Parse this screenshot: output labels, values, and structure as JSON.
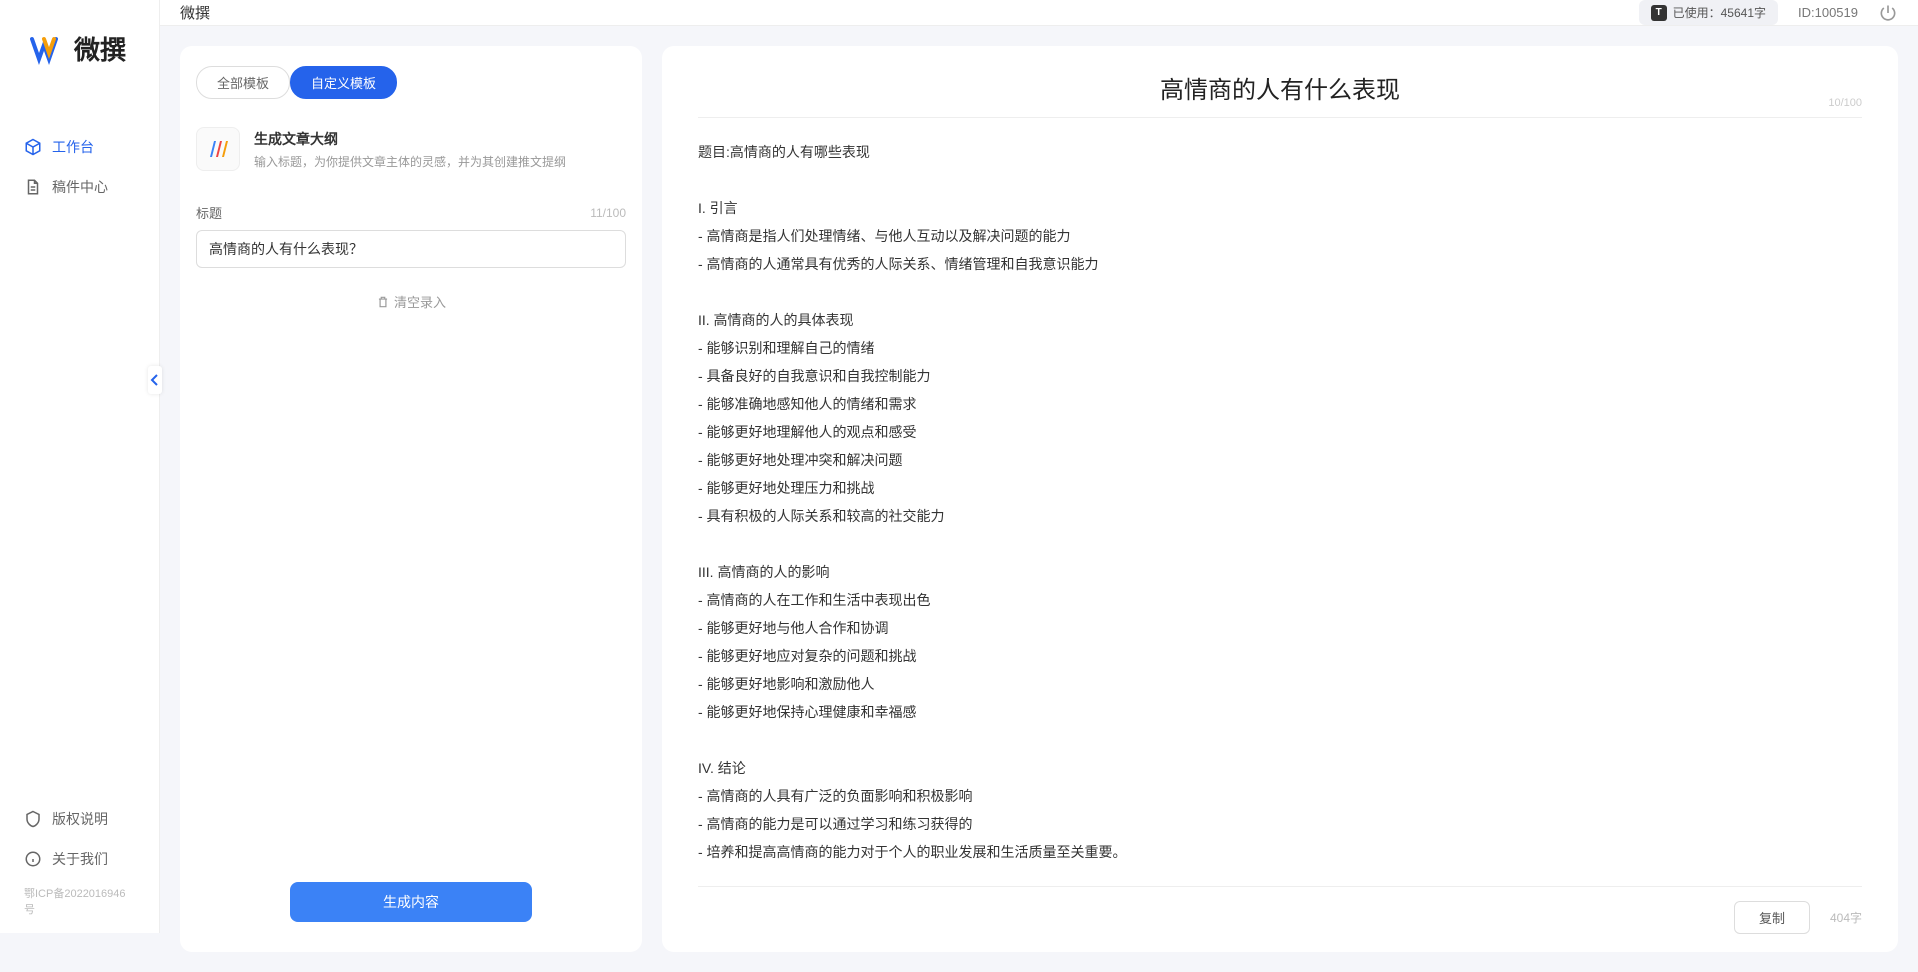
{
  "brand": {
    "name": "微撰"
  },
  "topbar": {
    "title": "微撰",
    "usage_label": "已使用：45641字",
    "user_id": "ID:100519"
  },
  "sidebar": {
    "nav": [
      {
        "label": "工作台",
        "active": true
      },
      {
        "label": "稿件中心",
        "active": false
      }
    ],
    "bottom": [
      {
        "label": "版权说明"
      },
      {
        "label": "关于我们"
      }
    ],
    "icp": "鄂ICP备2022016946号"
  },
  "left": {
    "tabs": [
      {
        "label": "全部模板",
        "active": false
      },
      {
        "label": "自定义模板",
        "active": true
      }
    ],
    "template": {
      "name": "生成文章大纲",
      "desc": "输入标题，为你提供文章主体的灵感，并为其创建推文提纲"
    },
    "form": {
      "title_label": "标题",
      "title_count": "11/100",
      "title_value": "高情商的人有什么表现？",
      "clear_label": "清空录入",
      "generate_label": "生成内容"
    }
  },
  "output": {
    "title": "高情商的人有什么表现",
    "top_count": "10/100",
    "body": "题目:高情商的人有哪些表现\n\nI. 引言\n- 高情商是指人们处理情绪、与他人互动以及解决问题的能力\n- 高情商的人通常具有优秀的人际关系、情绪管理和自我意识能力\n\nII. 高情商的人的具体表现\n- 能够识别和理解自己的情绪\n- 具备良好的自我意识和自我控制能力\n- 能够准确地感知他人的情绪和需求\n- 能够更好地理解他人的观点和感受\n- 能够更好地处理冲突和解决问题\n- 能够更好地处理压力和挑战\n- 具有积极的人际关系和较高的社交能力\n\nIII. 高情商的人的影响\n- 高情商的人在工作和生活中表现出色\n- 能够更好地与他人合作和协调\n- 能够更好地应对复杂的问题和挑战\n- 能够更好地影响和激励他人\n- 能够更好地保持心理健康和幸福感\n\nIV. 结论\n- 高情商的人具有广泛的负面影响和积极影响\n- 高情商的能力是可以通过学习和练习获得的\n- 培养和提高高情商的能力对于个人的职业发展和生活质量至关重要。",
    "copy_label": "复制",
    "word_count": "404字"
  }
}
